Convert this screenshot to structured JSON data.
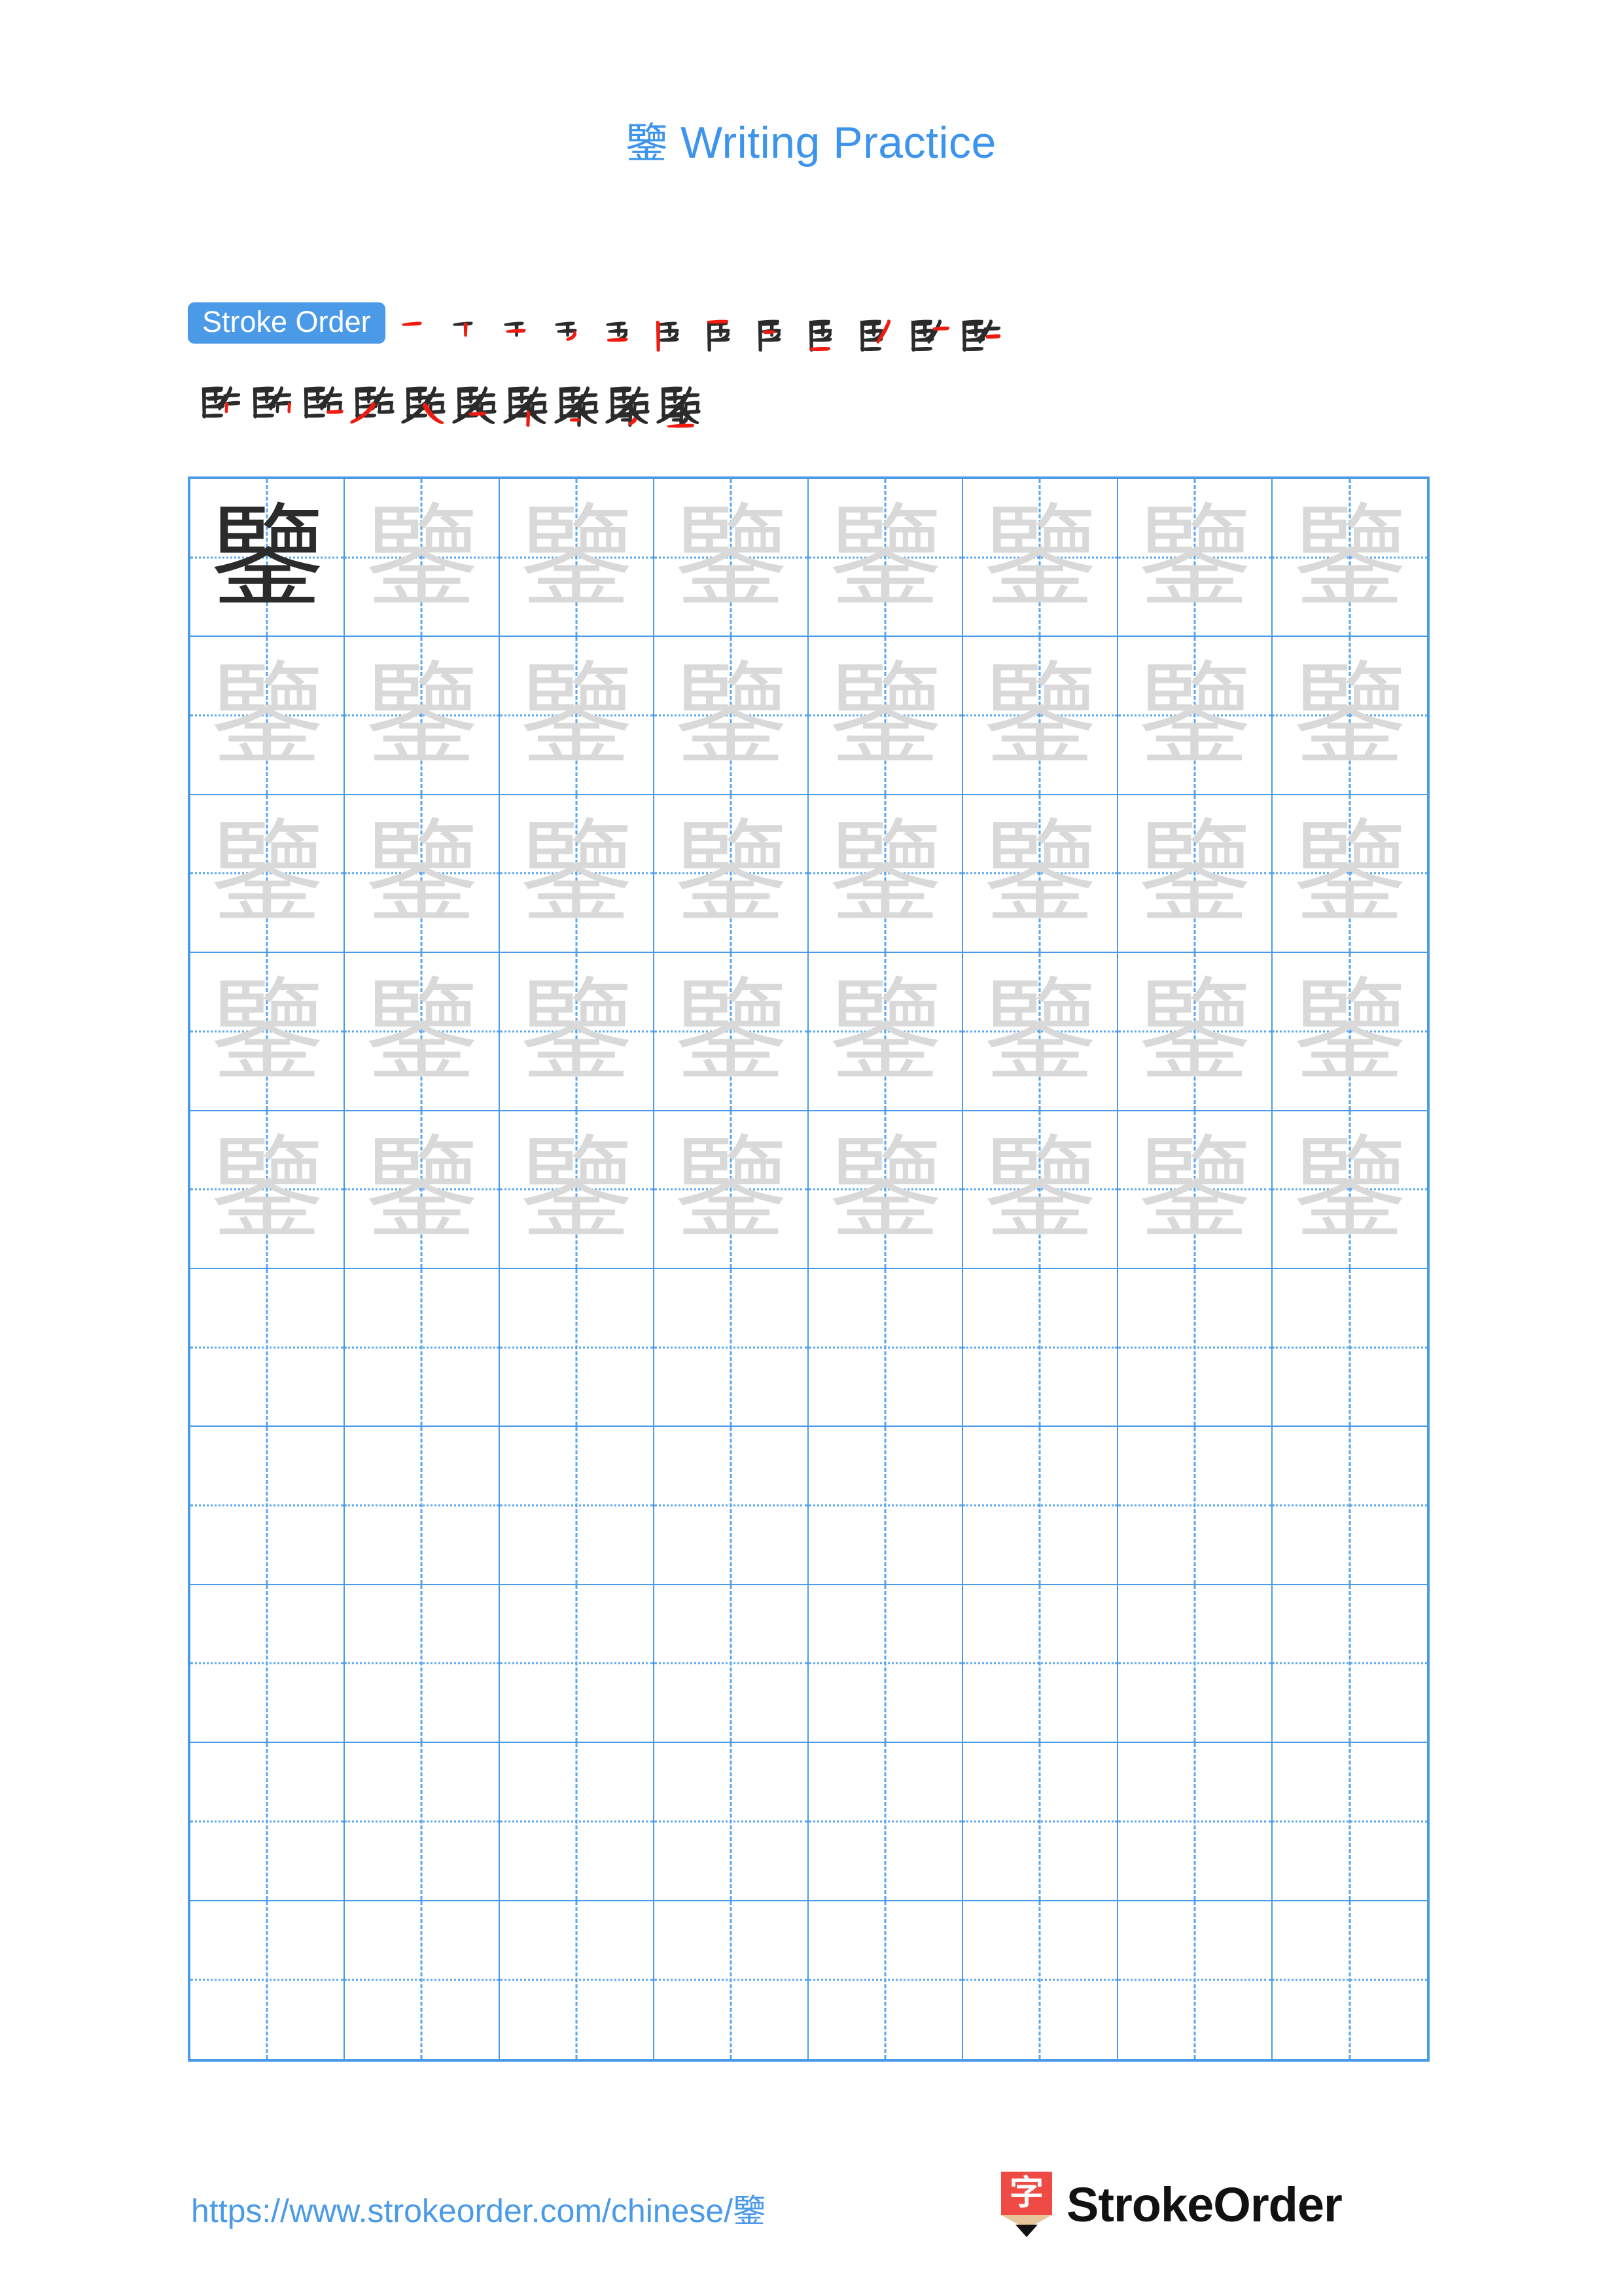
{
  "page": {
    "character": "鑒",
    "title_suffix": " Writing Practice",
    "accent_blue": "#4a9ae8",
    "title_blue": "#3d94ec",
    "stroke_done_color": "#2b2b2b",
    "stroke_latest_color": "#ee1b11",
    "trace_gray": "#d9d9d9",
    "logo_red": "#f04a44"
  },
  "stroke_order": {
    "badge_label": "Stroke Order",
    "total_strokes": 22,
    "row1_count": 12,
    "row2_count": 10,
    "steps": [
      {
        "index": 1,
        "glyph": "一"
      },
      {
        "index": 2,
        "glyph": "丅"
      },
      {
        "index": 3,
        "glyph": "丆"
      },
      {
        "index": 4,
        "glyph": "牙"
      },
      {
        "index": 5,
        "glyph": "牙"
      },
      {
        "index": 6,
        "glyph": "臣"
      },
      {
        "index": 7,
        "glyph": "臣丿"
      },
      {
        "index": 8,
        "glyph": "臣𠂆"
      },
      {
        "index": 9,
        "glyph": "臣𠂇"
      },
      {
        "index": 10,
        "glyph": "臥"
      },
      {
        "index": 11,
        "glyph": "臨"
      },
      {
        "index": 12,
        "glyph": "臨"
      },
      {
        "index": 13,
        "glyph": "臨"
      },
      {
        "index": 14,
        "glyph": "臨"
      },
      {
        "index": 15,
        "glyph": "臨"
      },
      {
        "index": 16,
        "glyph": "𧶠"
      },
      {
        "index": 17,
        "glyph": "鑒"
      },
      {
        "index": 18,
        "glyph": "鑒"
      },
      {
        "index": 19,
        "glyph": "鑒"
      },
      {
        "index": 20,
        "glyph": "鑒"
      },
      {
        "index": 21,
        "glyph": "鑒"
      },
      {
        "index": 22,
        "glyph": "鑒"
      }
    ]
  },
  "grid": {
    "columns": 8,
    "rows": 10,
    "filled_rows": 5,
    "empty_rows": 5,
    "model_cell": {
      "row": 1,
      "col": 1,
      "char": "鑒",
      "style": "model"
    },
    "trace_char": "鑒"
  },
  "footer": {
    "url": "https://www.strokeorder.com/chinese/鑒",
    "brand": "StrokeOrder",
    "logo_char": "字"
  }
}
